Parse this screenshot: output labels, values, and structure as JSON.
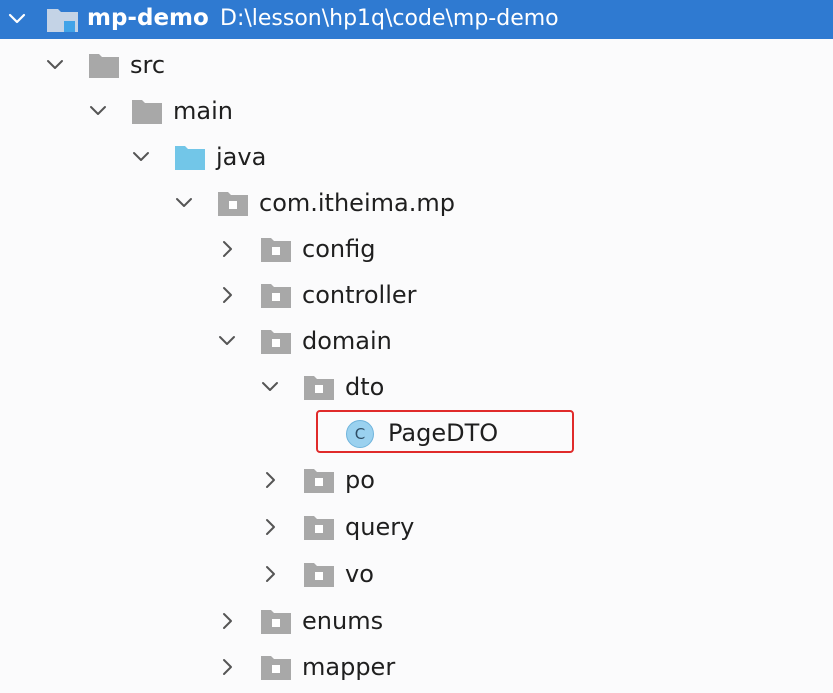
{
  "root": {
    "name": "mp-demo",
    "path": "D:\\lesson\\hp1q\\code\\mp-demo"
  },
  "tree": {
    "src": "src",
    "main": "main",
    "java": "java",
    "package": "com.itheima.mp",
    "config": "config",
    "controller": "controller",
    "domain": "domain",
    "dto": "dto",
    "page_dto": "PageDTO",
    "page_dto_icon_letter": "C",
    "po": "po",
    "query": "query",
    "vo": "vo",
    "enums": "enums",
    "mapper": "mapper"
  },
  "colors": {
    "selection": "#2f7ad1",
    "folder": "#a8a8a8",
    "source_folder": "#72c6e8",
    "class_icon": "#9ad1ef",
    "highlight_border": "#e02b2b"
  },
  "icons": {
    "expanded": "chevron-down-icon",
    "collapsed": "chevron-right-icon",
    "folder": "folder-icon",
    "package": "package-icon",
    "source_root": "source-root-folder-icon",
    "class": "class-icon"
  }
}
